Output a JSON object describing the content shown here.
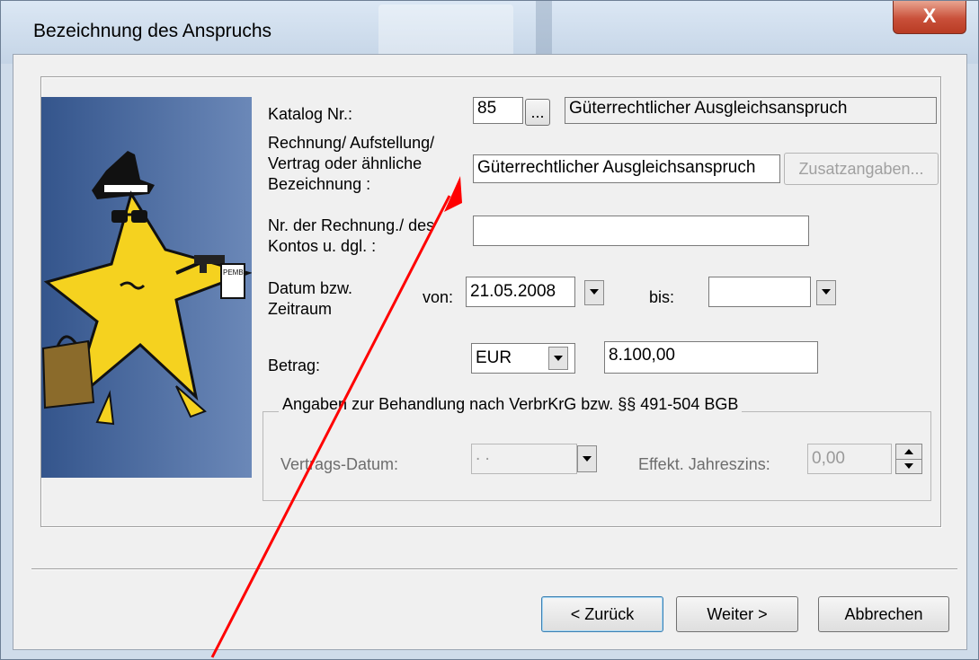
{
  "window": {
    "title": "Bezeichnung des Anspruchs",
    "close_symbol": "X"
  },
  "form": {
    "katalog": {
      "label": "Katalog Nr.:",
      "value": "85",
      "browse_label": "...",
      "description": "Güterrechtlicher Ausgleichsanspruch"
    },
    "bezeichnung": {
      "label_lines": [
        "Rechnung/ Aufstellung/",
        "Vertrag oder ähnliche",
        "Bezeichnung :"
      ],
      "value": "Güterrechtlicher Ausgleichsanspruch",
      "zusatz_label": "Zusatzangaben..."
    },
    "nummer": {
      "label_lines": [
        "Nr. der Rechnung./ des",
        "Kontos u. dgl. :"
      ],
      "value": ""
    },
    "datum": {
      "label_lines": [
        "Datum bzw.",
        "Zeitraum"
      ],
      "von_label": "von:",
      "von_value": "21.05.2008",
      "bis_label": "bis:",
      "bis_value": ""
    },
    "betrag": {
      "label": "Betrag:",
      "currency": "EUR",
      "value": "8.100,00"
    },
    "verbrkrg": {
      "group_label": "Angaben zur Behandlung nach VerbrKrG bzw. §§ 491-504 BGB",
      "vertragsdatum_label": "Vertrags-Datum:",
      "vertragsdatum_value": " .  .",
      "jahreszins_label": "Effekt. Jahreszins:",
      "jahreszins_value": "0,00"
    }
  },
  "buttons": {
    "back": "< Zurück",
    "next": "Weiter >",
    "cancel": "Abbrechen"
  },
  "banner": {
    "sign_text": "PEMB"
  },
  "colors": {
    "annotation_arrow": "#ff0000",
    "banner_dark": "#34558c",
    "star": "#f5d21f"
  }
}
